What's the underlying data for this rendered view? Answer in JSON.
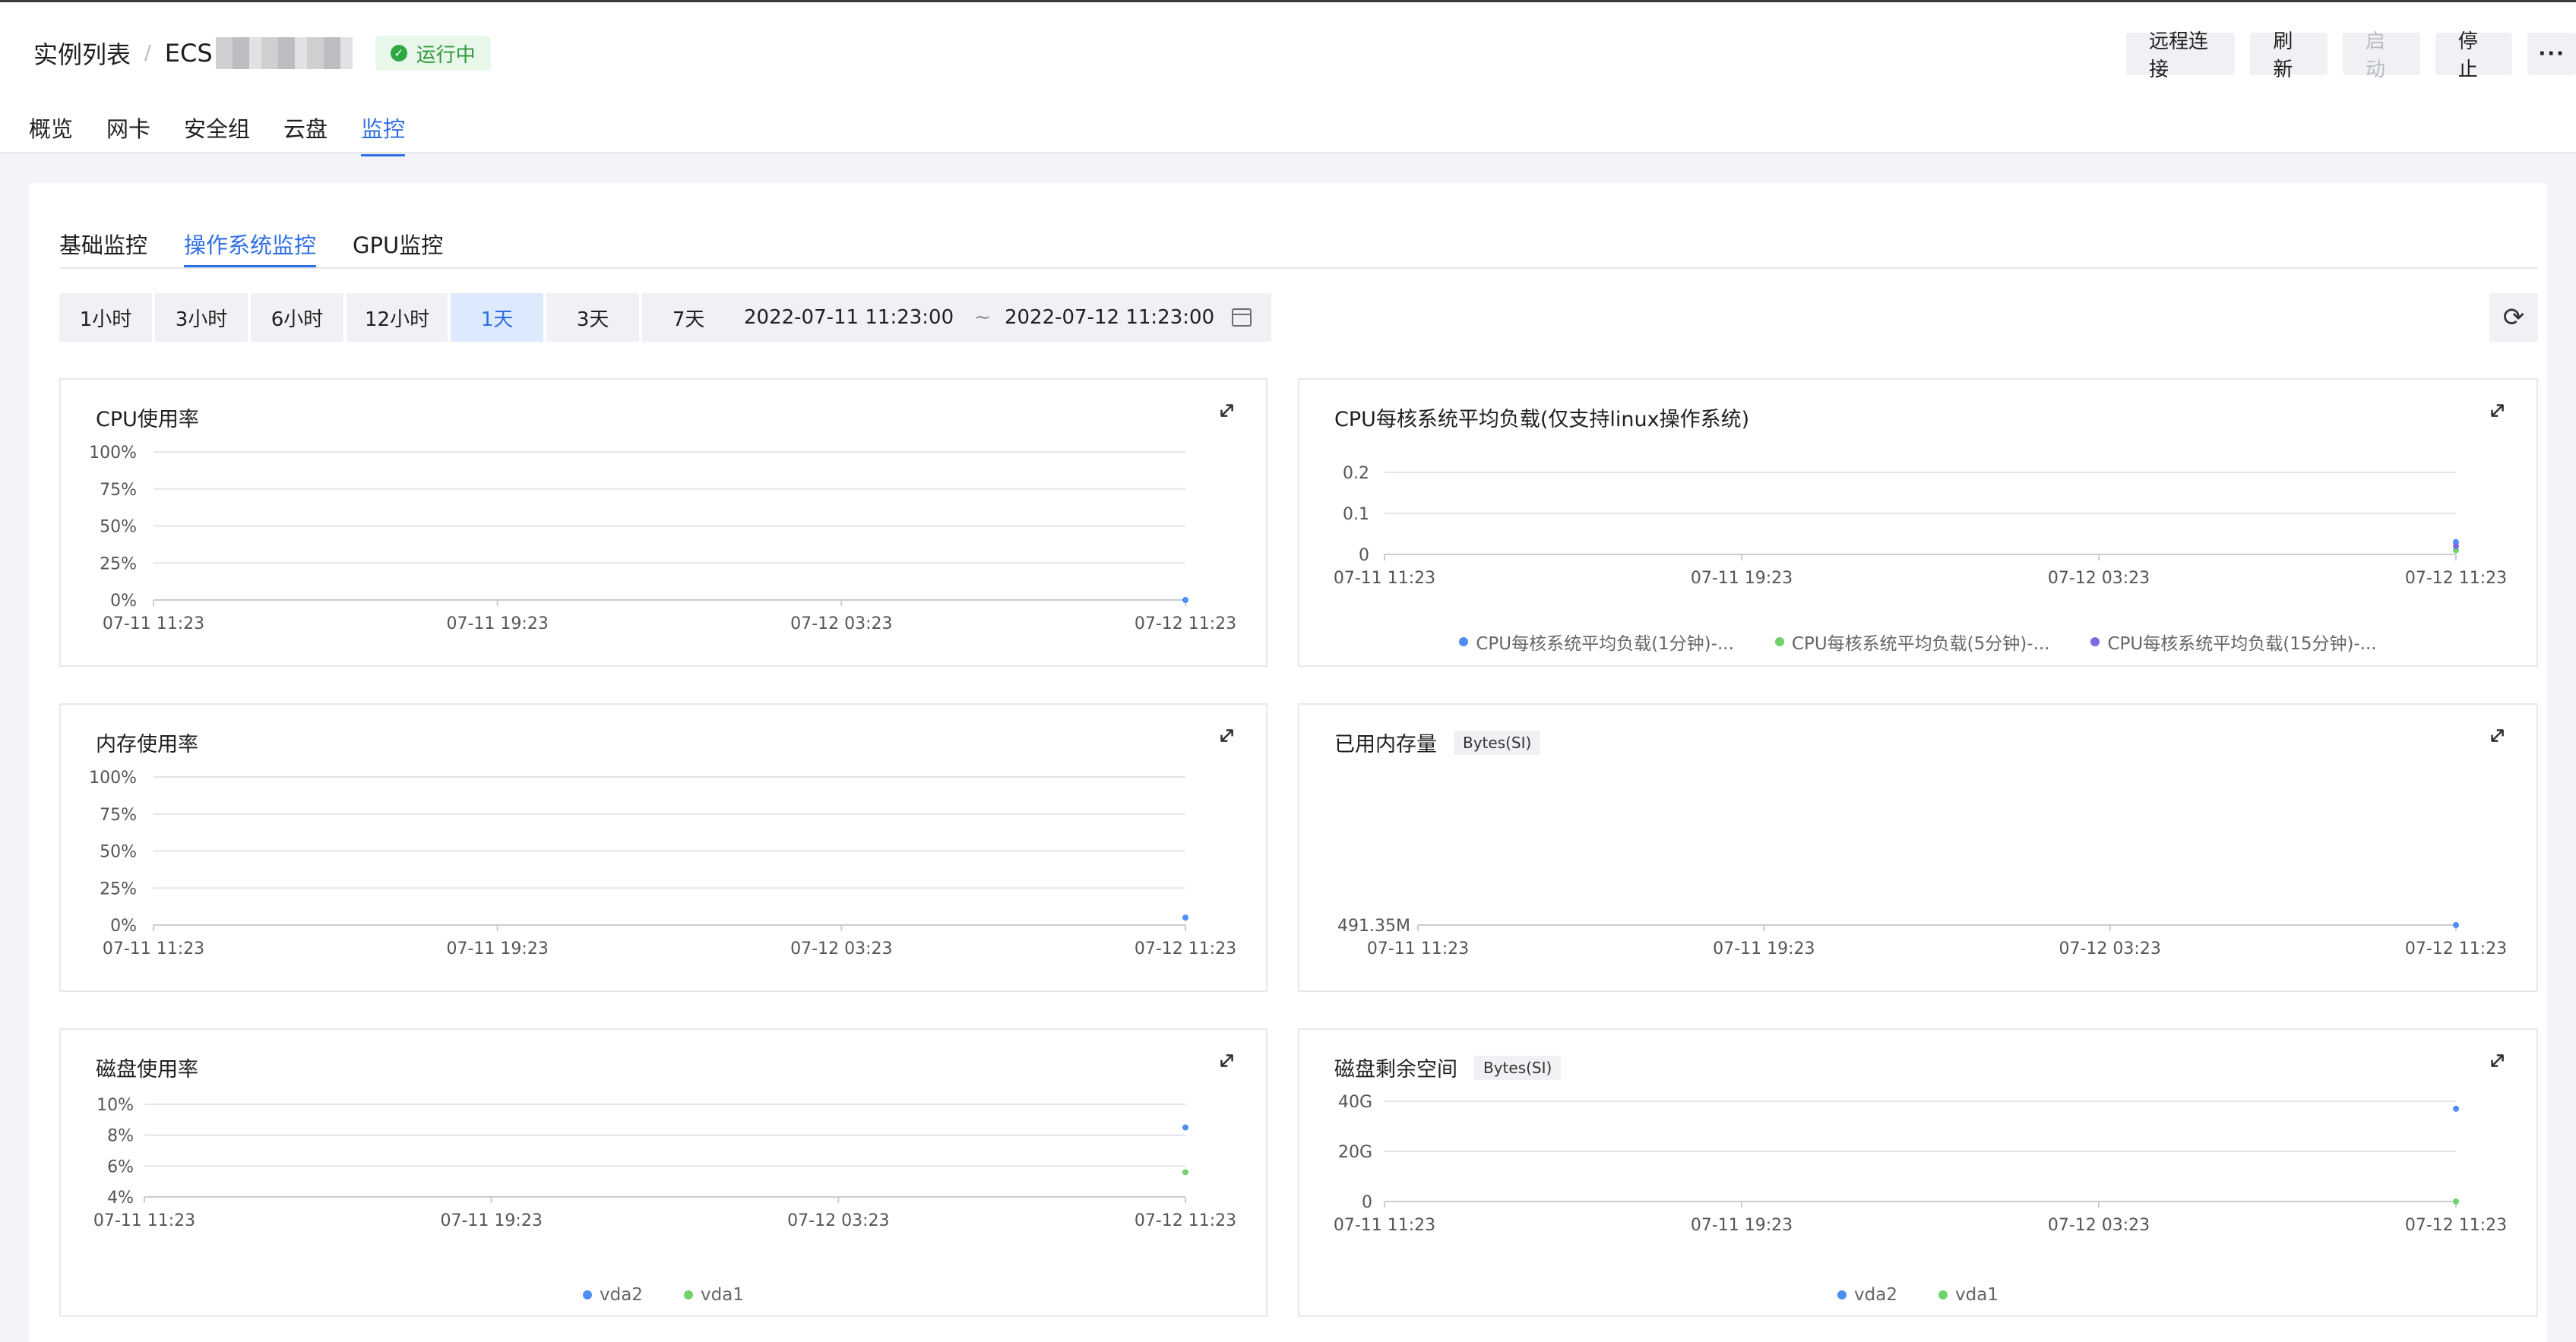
{
  "header": {
    "breadcrumb_root": "实例列表",
    "breadcrumb_sep": "/",
    "instance_name": "ECS",
    "status": "运行中",
    "status_icon": "check-circle-icon",
    "actions": [
      "远程连接",
      "刷新",
      "启动",
      "停止"
    ],
    "more": "···",
    "tabs": [
      "概览",
      "网卡",
      "安全组",
      "云盘",
      "监控"
    ],
    "active_tab": "监控"
  },
  "monitor": {
    "subtabs": [
      "基础监控",
      "操作系统监控",
      "GPU监控"
    ],
    "active_subtab": "操作系统监控",
    "ranges": [
      "1小时",
      "3小时",
      "6小时",
      "12小时",
      "1天",
      "3天",
      "7天"
    ],
    "active_range": "1天",
    "start": "2022-07-11 11:23:00",
    "tilde": "~",
    "end": "2022-07-12 11:23:00"
  },
  "colors": {
    "accent": "#2f6fe6",
    "series_blue": "#4d8df5",
    "series_green": "#6fd26b",
    "series_purple": "#7a6be0"
  },
  "chart_data": [
    {
      "type": "line",
      "title": "CPU使用率",
      "yticks": [
        "100%",
        "75%",
        "50%",
        "25%",
        "0%"
      ],
      "ylim": [
        0,
        100
      ],
      "xticks": [
        "07-11 11:23",
        "07-11 19:23",
        "07-12 03:23",
        "07-12 11:23"
      ],
      "series": [
        {
          "color": "#4d8df5",
          "points": [
            [
              1,
              0
            ]
          ]
        }
      ],
      "legend": []
    },
    {
      "type": "line",
      "title": "CPU每核系统平均负载(仅支持linux操作系统)",
      "yticks": [
        "0.2",
        "0.1",
        "0"
      ],
      "ylim": [
        0,
        0.2
      ],
      "xticks": [
        "07-11 11:23",
        "07-11 19:23",
        "07-12 03:23",
        "07-12 11:23"
      ],
      "series": [
        {
          "name": "CPU每核系统平均负载(1分钟)-...",
          "color": "#4d8df5",
          "points": [
            [
              1,
              0.03
            ]
          ]
        },
        {
          "name": "CPU每核系统平均负载(5分钟)-...",
          "color": "#6fd26b",
          "points": [
            [
              1,
              0.01
            ]
          ]
        },
        {
          "name": "CPU每核系统平均负载(15分钟)-...",
          "color": "#7a6be0",
          "points": [
            [
              1,
              0.02
            ]
          ]
        }
      ],
      "legend": [
        "CPU每核系统平均负载(1分钟)-...",
        "CPU每核系统平均负载(5分钟)-...",
        "CPU每核系统平均负载(15分钟)-..."
      ]
    },
    {
      "type": "line",
      "title": "内存使用率",
      "yticks": [
        "100%",
        "75%",
        "50%",
        "25%",
        "0%"
      ],
      "ylim": [
        0,
        100
      ],
      "xticks": [
        "07-11 11:23",
        "07-11 19:23",
        "07-12 03:23",
        "07-12 11:23"
      ],
      "series": [
        {
          "color": "#4d8df5",
          "points": [
            [
              1,
              5
            ]
          ]
        }
      ],
      "legend": []
    },
    {
      "type": "line",
      "title": "已用内存量",
      "unit": "Bytes(SI)",
      "yticks": [
        "491.35M"
      ],
      "ylim": [
        0,
        1
      ],
      "xticks": [
        "07-11 11:23",
        "07-11 19:23",
        "07-12 03:23",
        "07-12 11:23"
      ],
      "series": [
        {
          "color": "#4d8df5",
          "points": [
            [
              1,
              0
            ]
          ]
        }
      ],
      "legend": []
    },
    {
      "type": "line",
      "title": "磁盘使用率",
      "yticks": [
        "10%",
        "8%",
        "6%",
        "4%"
      ],
      "ylim": [
        4,
        10
      ],
      "xticks": [
        "07-11 11:23",
        "07-11 19:23",
        "07-12 03:23",
        "07-12 11:23"
      ],
      "series": [
        {
          "name": "vda2",
          "color": "#4d8df5",
          "points": [
            [
              1,
              8.5
            ]
          ]
        },
        {
          "name": "vda1",
          "color": "#6fd26b",
          "points": [
            [
              1,
              5.6
            ]
          ]
        }
      ],
      "legend": [
        "vda2",
        "vda1"
      ]
    },
    {
      "type": "line",
      "title": "磁盘剩余空间",
      "unit": "Bytes(SI)",
      "yticks": [
        "40G",
        "20G",
        "0"
      ],
      "ylim": [
        0,
        40
      ],
      "xticks": [
        "07-11 11:23",
        "07-11 19:23",
        "07-12 03:23",
        "07-12 11:23"
      ],
      "series": [
        {
          "name": "vda2",
          "color": "#4d8df5",
          "points": [
            [
              1,
              37
            ]
          ]
        },
        {
          "name": "vda1",
          "color": "#6fd26b",
          "points": [
            [
              1,
              0
            ]
          ]
        }
      ],
      "legend": [
        "vda2",
        "vda1"
      ]
    }
  ]
}
